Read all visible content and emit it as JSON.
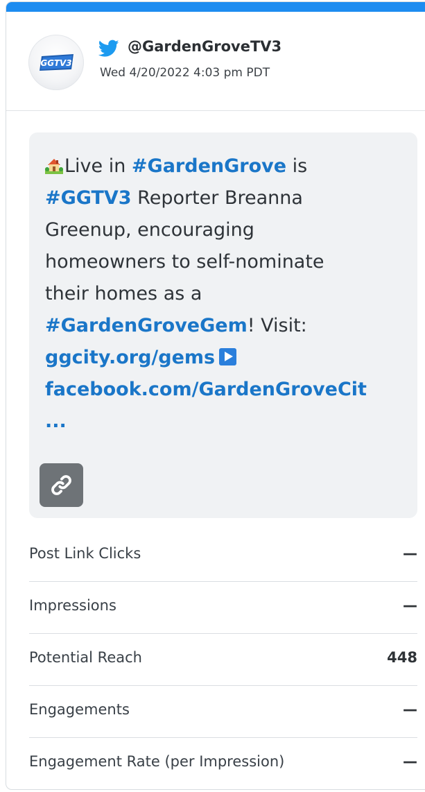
{
  "post": {
    "handle": "@GardenGroveTV3",
    "timestamp": "Wed 4/20/2022 4:03 pm PDT",
    "avatar_text": "GGTV3",
    "text": {
      "l1_emoji": "house-with-garden-icon",
      "l1_a": "Live in ",
      "l1_tag": "#GardenGrove",
      "l1_b": " is",
      "l2_tag": "#GGTV3",
      "l2_b": " Reporter Breanna",
      "l3": "Greenup, encouraging",
      "l4": "homeowners to self-nominate",
      "l5": "their homes as a",
      "l6_tag": "#GardenGroveGem",
      "l6_b": "! Visit:",
      "l7_link": "ggcity.org/gems",
      "l8_link": "facebook.com/GardenGroveCit",
      "l9_more": "..."
    }
  },
  "metrics": [
    {
      "label": "Post Link Clicks",
      "value": "—"
    },
    {
      "label": "Impressions",
      "value": "—"
    },
    {
      "label": "Potential Reach",
      "value": "448"
    },
    {
      "label": "Engagements",
      "value": "—"
    },
    {
      "label": "Engagement Rate (per Impression)",
      "value": "—"
    }
  ],
  "colors": {
    "accent": "#1d8cf0",
    "link": "#1a76c8",
    "link_button_bg": "#6e7377",
    "post_bg": "#f0f2f4"
  }
}
